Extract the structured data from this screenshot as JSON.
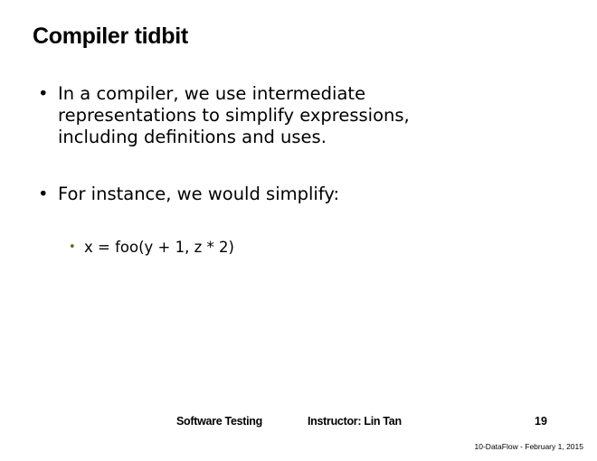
{
  "slide": {
    "title": "Compiler tidbit",
    "bullets": [
      {
        "text": "In a compiler, we use intermediate\nrepresentations to simplify expressions,\nincluding definitions and uses."
      },
      {
        "text": "For instance, we would simplify:"
      }
    ],
    "sub_bullets": [
      {
        "text": "x = foo(y + 1, z * 2)"
      }
    ],
    "bullet_glyph": "•",
    "sub_bullet_color": "#5a6b1e"
  },
  "footer": {
    "course": "Software Testing",
    "instructor": "Instructor: Lin Tan",
    "page_number": "19",
    "tag": "10-DataFlow - February 1, 2015"
  }
}
